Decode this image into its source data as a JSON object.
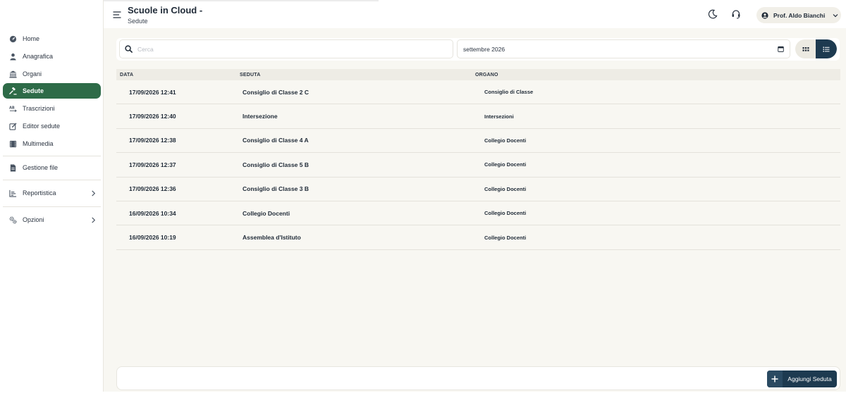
{
  "app": {
    "title": "Scuole in Cloud -",
    "subtitle": "Sedute"
  },
  "user": {
    "name": "Prof. Aldo Bianchi"
  },
  "sidebar": {
    "items": [
      {
        "label": "Home",
        "icon": "dashboard-icon"
      },
      {
        "label": "Anagrafica",
        "icon": "user-icon"
      },
      {
        "label": "Organi",
        "icon": "institution-icon"
      },
      {
        "label": "Sedute",
        "icon": "gavel-icon",
        "active": true
      },
      {
        "label": "Trascrizioni",
        "icon": "transcription-icon"
      },
      {
        "label": "Editor sedute",
        "icon": "edit-icon"
      },
      {
        "label": "Multimedia",
        "icon": "film-icon"
      },
      {
        "label": "Gestione file",
        "icon": "file-icon"
      },
      {
        "label": "Reportistica",
        "icon": "report-icon",
        "expandable": true
      },
      {
        "label": "Opzioni",
        "icon": "settings-icon",
        "expandable": true
      }
    ]
  },
  "filters": {
    "search_placeholder": "Cerca",
    "search_value": "",
    "month": "settembre 2026"
  },
  "table": {
    "headers": {
      "date": "DATA",
      "seduta": "SEDUTA",
      "organo": "ORGANO"
    },
    "rows": [
      {
        "date": "17/09/2026 12:41",
        "seduta": "Consiglio di Classe 2 C",
        "organo": "Consiglio di Classe"
      },
      {
        "date": "17/09/2026 12:40",
        "seduta": "Intersezione",
        "organo": "Intersezioni"
      },
      {
        "date": "17/09/2026 12:38",
        "seduta": "Consiglio di Classe 4 A",
        "organo": "Collegio Docenti"
      },
      {
        "date": "17/09/2026 12:37",
        "seduta": "Consiglio di Classe 5 B",
        "organo": "Collegio Docenti"
      },
      {
        "date": "17/09/2026 12:36",
        "seduta": "Consiglio di Classe 3 B",
        "organo": "Collegio Docenti"
      },
      {
        "date": "16/09/2026 10:34",
        "seduta": "Collegio Docenti",
        "organo": "Collegio Docenti"
      },
      {
        "date": "16/09/2026 10:19",
        "seduta": "Assemblea d'Istituto",
        "organo": "Collegio Docenti"
      }
    ]
  },
  "actions": {
    "add_label": "Aggiungi Seduta"
  },
  "colors": {
    "accent": "#2e6b48",
    "primary_dark": "#1d3a50",
    "background": "#f8f7f2"
  }
}
